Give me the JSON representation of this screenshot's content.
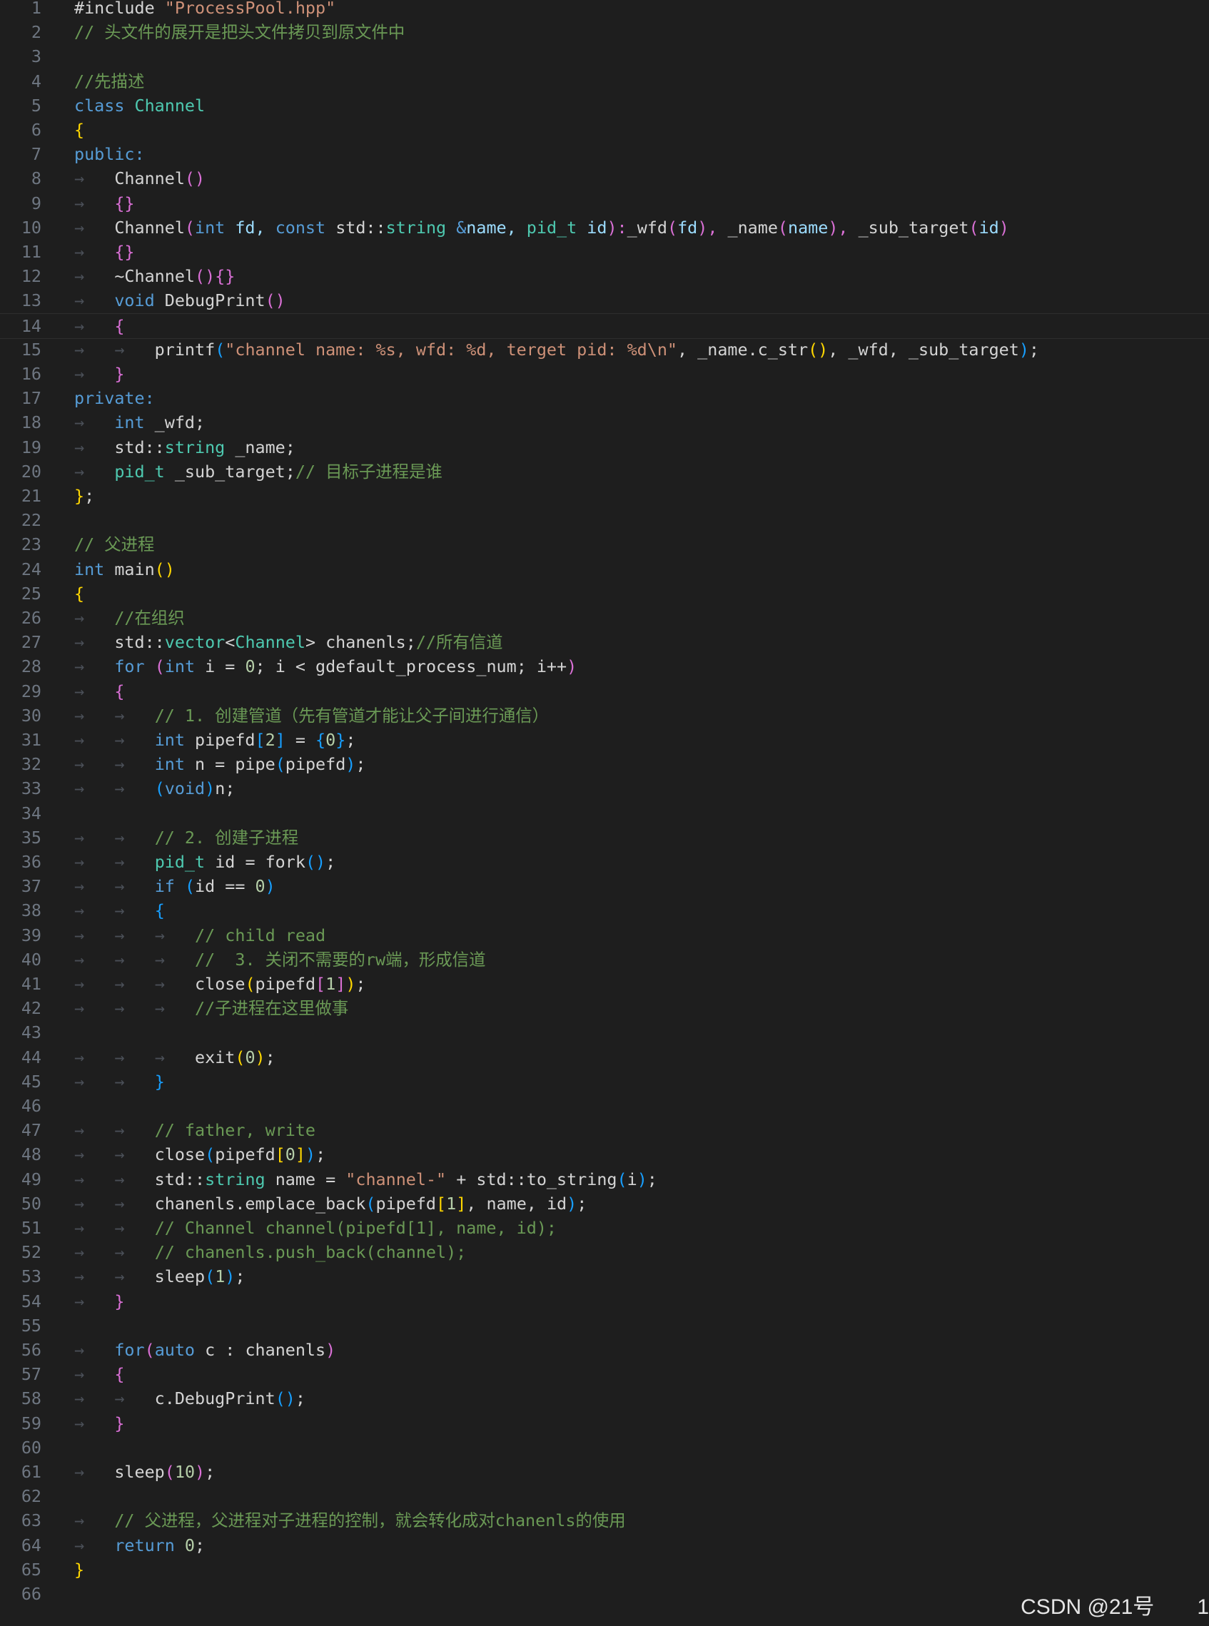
{
  "editor": {
    "lines": [
      [
        [
          "#include ",
          "plain"
        ],
        [
          "\"ProcessPool.hpp\"",
          "str"
        ]
      ],
      [
        [
          "// 头文件的展开是把头文件拷贝到原文件中",
          "cmt"
        ]
      ],
      [],
      [
        [
          "//先描述",
          "cmt"
        ]
      ],
      [
        [
          "class ",
          "kw"
        ],
        [
          "Channel",
          "type"
        ]
      ],
      [
        [
          "{",
          "br1"
        ]
      ],
      [
        [
          "public:",
          "kw"
        ]
      ],
      [
        [
          "→",
          "ws"
        ],
        [
          "   Channel",
          "plain"
        ],
        [
          "()",
          "br2"
        ]
      ],
      [
        [
          "→",
          "ws"
        ],
        [
          "   ",
          "plain"
        ],
        [
          "{}",
          "br2"
        ]
      ],
      [
        [
          "→",
          "ws"
        ],
        [
          "   Channel",
          "plain"
        ],
        [
          "(",
          "br2"
        ],
        [
          "int",
          "kw"
        ],
        [
          " fd, ",
          "param"
        ],
        [
          "const ",
          "kw"
        ],
        [
          "std::",
          "plain"
        ],
        [
          "string",
          "type"
        ],
        [
          " &",
          "kw"
        ],
        [
          "name, ",
          "param"
        ],
        [
          "pid_t",
          "type"
        ],
        [
          " id",
          "param"
        ],
        [
          "):",
          "br2"
        ],
        [
          "_wfd",
          "plain"
        ],
        [
          "(",
          "br2"
        ],
        [
          "fd",
          "param"
        ],
        [
          "), ",
          "br2"
        ],
        [
          "_name",
          "plain"
        ],
        [
          "(",
          "br2"
        ],
        [
          "name",
          "param"
        ],
        [
          "), ",
          "br2"
        ],
        [
          "_sub_target",
          "plain"
        ],
        [
          "(",
          "br2"
        ],
        [
          "id",
          "param"
        ],
        [
          ")",
          "br2"
        ]
      ],
      [
        [
          "→",
          "ws"
        ],
        [
          "   ",
          "plain"
        ],
        [
          "{}",
          "br2"
        ]
      ],
      [
        [
          "→",
          "ws"
        ],
        [
          "   ~Channel",
          "plain"
        ],
        [
          "(){}",
          "br2"
        ]
      ],
      [
        [
          "→",
          "ws"
        ],
        [
          "   ",
          "plain"
        ],
        [
          "void ",
          "kw"
        ],
        [
          "DebugPrint",
          "plain"
        ],
        [
          "()",
          "br2"
        ]
      ],
      [
        [
          "→",
          "ws"
        ],
        [
          "   ",
          "plain"
        ],
        [
          "{",
          "br2"
        ]
      ],
      [
        [
          "→",
          "ws"
        ],
        [
          "   ",
          "plain"
        ],
        [
          "→",
          "ws"
        ],
        [
          "   printf",
          "plain"
        ],
        [
          "(",
          "br3"
        ],
        [
          "\"channel name: %s, wfd: %d, terget pid: %d\\n\"",
          "str"
        ],
        [
          ", _name.c_str",
          "plain"
        ],
        [
          "()",
          "br1"
        ],
        [
          ", _wfd, _sub_target",
          "plain"
        ],
        [
          ")",
          "br3"
        ],
        [
          ";",
          "plain"
        ]
      ],
      [
        [
          "→",
          "ws"
        ],
        [
          "   ",
          "plain"
        ],
        [
          "}",
          "br2"
        ]
      ],
      [
        [
          "private:",
          "kw"
        ]
      ],
      [
        [
          "→",
          "ws"
        ],
        [
          "   ",
          "plain"
        ],
        [
          "int",
          "kw"
        ],
        [
          " _wfd;",
          "plain"
        ]
      ],
      [
        [
          "→",
          "ws"
        ],
        [
          "   std::",
          "plain"
        ],
        [
          "string",
          "type"
        ],
        [
          " _name;",
          "plain"
        ]
      ],
      [
        [
          "→",
          "ws"
        ],
        [
          "   ",
          "plain"
        ],
        [
          "pid_t",
          "type"
        ],
        [
          " _sub_target;",
          "plain"
        ],
        [
          "// 目标子进程是谁",
          "cmt"
        ]
      ],
      [
        [
          "}",
          "br1"
        ],
        [
          ";",
          "plain"
        ]
      ],
      [],
      [
        [
          "// 父进程",
          "cmt"
        ]
      ],
      [
        [
          "int",
          "kw"
        ],
        [
          " main",
          "plain"
        ],
        [
          "()",
          "br1"
        ]
      ],
      [
        [
          "{",
          "br1"
        ]
      ],
      [
        [
          "→",
          "ws"
        ],
        [
          "   ",
          "plain"
        ],
        [
          "//在组织",
          "cmt"
        ]
      ],
      [
        [
          "→",
          "ws"
        ],
        [
          "   std::",
          "plain"
        ],
        [
          "vector",
          "type"
        ],
        [
          "<",
          "plain"
        ],
        [
          "Channel",
          "type"
        ],
        [
          "> chanenls;",
          "plain"
        ],
        [
          "//所有信道",
          "cmt"
        ]
      ],
      [
        [
          "→",
          "ws"
        ],
        [
          "   ",
          "plain"
        ],
        [
          "for ",
          "kw"
        ],
        [
          "(",
          "br2"
        ],
        [
          "int",
          "kw"
        ],
        [
          " i = ",
          "plain"
        ],
        [
          "0",
          "num"
        ],
        [
          "; i < gdefault_process_num; i++",
          "plain"
        ],
        [
          ")",
          "br2"
        ]
      ],
      [
        [
          "→",
          "ws"
        ],
        [
          "   ",
          "plain"
        ],
        [
          "{",
          "br2"
        ]
      ],
      [
        [
          "→",
          "ws"
        ],
        [
          "   ",
          "plain"
        ],
        [
          "→",
          "ws"
        ],
        [
          "   ",
          "plain"
        ],
        [
          "// 1. 创建管道（先有管道才能让父子间进行通信）",
          "cmt"
        ]
      ],
      [
        [
          "→",
          "ws"
        ],
        [
          "   ",
          "plain"
        ],
        [
          "→",
          "ws"
        ],
        [
          "   ",
          "plain"
        ],
        [
          "int",
          "kw"
        ],
        [
          " pipefd",
          "plain"
        ],
        [
          "[",
          "br3"
        ],
        [
          "2",
          "num"
        ],
        [
          "]",
          "br3"
        ],
        [
          " = ",
          "plain"
        ],
        [
          "{",
          "br3"
        ],
        [
          "0",
          "num"
        ],
        [
          "}",
          "br3"
        ],
        [
          ";",
          "plain"
        ]
      ],
      [
        [
          "→",
          "ws"
        ],
        [
          "   ",
          "plain"
        ],
        [
          "→",
          "ws"
        ],
        [
          "   ",
          "plain"
        ],
        [
          "int",
          "kw"
        ],
        [
          " n = pipe",
          "plain"
        ],
        [
          "(",
          "br3"
        ],
        [
          "pipefd",
          "plain"
        ],
        [
          ")",
          "br3"
        ],
        [
          ";",
          "plain"
        ]
      ],
      [
        [
          "→",
          "ws"
        ],
        [
          "   ",
          "plain"
        ],
        [
          "→",
          "ws"
        ],
        [
          "   ",
          "plain"
        ],
        [
          "(",
          "br3"
        ],
        [
          "void",
          "kw"
        ],
        [
          ")",
          "br3"
        ],
        [
          "n;",
          "plain"
        ]
      ],
      [],
      [
        [
          "→",
          "ws"
        ],
        [
          "   ",
          "plain"
        ],
        [
          "→",
          "ws"
        ],
        [
          "   ",
          "plain"
        ],
        [
          "// 2. 创建子进程",
          "cmt"
        ]
      ],
      [
        [
          "→",
          "ws"
        ],
        [
          "   ",
          "plain"
        ],
        [
          "→",
          "ws"
        ],
        [
          "   ",
          "plain"
        ],
        [
          "pid_t",
          "type"
        ],
        [
          " id = fork",
          "plain"
        ],
        [
          "()",
          "br3"
        ],
        [
          ";",
          "plain"
        ]
      ],
      [
        [
          "→",
          "ws"
        ],
        [
          "   ",
          "plain"
        ],
        [
          "→",
          "ws"
        ],
        [
          "   ",
          "plain"
        ],
        [
          "if ",
          "kw"
        ],
        [
          "(",
          "br3"
        ],
        [
          "id == ",
          "plain"
        ],
        [
          "0",
          "num"
        ],
        [
          ")",
          "br3"
        ]
      ],
      [
        [
          "→",
          "ws"
        ],
        [
          "   ",
          "plain"
        ],
        [
          "→",
          "ws"
        ],
        [
          "   ",
          "plain"
        ],
        [
          "{",
          "br3"
        ]
      ],
      [
        [
          "→",
          "ws"
        ],
        [
          "   ",
          "plain"
        ],
        [
          "→",
          "ws"
        ],
        [
          "   ",
          "plain"
        ],
        [
          "→",
          "ws"
        ],
        [
          "   ",
          "plain"
        ],
        [
          "// child read",
          "cmt"
        ]
      ],
      [
        [
          "→",
          "ws"
        ],
        [
          "   ",
          "plain"
        ],
        [
          "→",
          "ws"
        ],
        [
          "   ",
          "plain"
        ],
        [
          "→",
          "ws"
        ],
        [
          "   ",
          "plain"
        ],
        [
          "//  3. 关闭不需要的rw端，形成信道",
          "cmt"
        ]
      ],
      [
        [
          "→",
          "ws"
        ],
        [
          "   ",
          "plain"
        ],
        [
          "→",
          "ws"
        ],
        [
          "   ",
          "plain"
        ],
        [
          "→",
          "ws"
        ],
        [
          "   close",
          "plain"
        ],
        [
          "(",
          "br1"
        ],
        [
          "pipefd",
          "plain"
        ],
        [
          "[",
          "br2"
        ],
        [
          "1",
          "num"
        ],
        [
          "]",
          "br2"
        ],
        [
          ")",
          "br1"
        ],
        [
          ";",
          "plain"
        ]
      ],
      [
        [
          "→",
          "ws"
        ],
        [
          "   ",
          "plain"
        ],
        [
          "→",
          "ws"
        ],
        [
          "   ",
          "plain"
        ],
        [
          "→",
          "ws"
        ],
        [
          "   ",
          "plain"
        ],
        [
          "//子进程在这里做事",
          "cmt"
        ]
      ],
      [],
      [
        [
          "→",
          "ws"
        ],
        [
          "   ",
          "plain"
        ],
        [
          "→",
          "ws"
        ],
        [
          "   ",
          "plain"
        ],
        [
          "→",
          "ws"
        ],
        [
          "   exit",
          "plain"
        ],
        [
          "(",
          "br1"
        ],
        [
          "0",
          "num"
        ],
        [
          ")",
          "br1"
        ],
        [
          ";",
          "plain"
        ]
      ],
      [
        [
          "→",
          "ws"
        ],
        [
          "   ",
          "plain"
        ],
        [
          "→",
          "ws"
        ],
        [
          "   ",
          "plain"
        ],
        [
          "}",
          "br3"
        ]
      ],
      [],
      [
        [
          "→",
          "ws"
        ],
        [
          "   ",
          "plain"
        ],
        [
          "→",
          "ws"
        ],
        [
          "   ",
          "plain"
        ],
        [
          "// father, write",
          "cmt"
        ]
      ],
      [
        [
          "→",
          "ws"
        ],
        [
          "   ",
          "plain"
        ],
        [
          "→",
          "ws"
        ],
        [
          "   close",
          "plain"
        ],
        [
          "(",
          "br3"
        ],
        [
          "pipefd",
          "plain"
        ],
        [
          "[",
          "br1"
        ],
        [
          "0",
          "num"
        ],
        [
          "]",
          "br1"
        ],
        [
          ")",
          "br3"
        ],
        [
          ";",
          "plain"
        ]
      ],
      [
        [
          "→",
          "ws"
        ],
        [
          "   ",
          "plain"
        ],
        [
          "→",
          "ws"
        ],
        [
          "   std::",
          "plain"
        ],
        [
          "string",
          "type"
        ],
        [
          " name = ",
          "plain"
        ],
        [
          "\"channel-\"",
          "str"
        ],
        [
          " + std::to_string",
          "plain"
        ],
        [
          "(",
          "br3"
        ],
        [
          "i",
          "plain"
        ],
        [
          ")",
          "br3"
        ],
        [
          ";",
          "plain"
        ]
      ],
      [
        [
          "→",
          "ws"
        ],
        [
          "   ",
          "plain"
        ],
        [
          "→",
          "ws"
        ],
        [
          "   chanenls.emplace_back",
          "plain"
        ],
        [
          "(",
          "br3"
        ],
        [
          "pipefd",
          "plain"
        ],
        [
          "[",
          "br1"
        ],
        [
          "1",
          "num"
        ],
        [
          "]",
          "br1"
        ],
        [
          ", name, id",
          "plain"
        ],
        [
          ")",
          "br3"
        ],
        [
          ";",
          "plain"
        ]
      ],
      [
        [
          "→",
          "ws"
        ],
        [
          "   ",
          "plain"
        ],
        [
          "→",
          "ws"
        ],
        [
          "   ",
          "plain"
        ],
        [
          "// Channel channel(pipefd[1], name, id);",
          "cmt"
        ]
      ],
      [
        [
          "→",
          "ws"
        ],
        [
          "   ",
          "plain"
        ],
        [
          "→",
          "ws"
        ],
        [
          "   ",
          "plain"
        ],
        [
          "// chanenls.push_back(channel);",
          "cmt"
        ]
      ],
      [
        [
          "→",
          "ws"
        ],
        [
          "   ",
          "plain"
        ],
        [
          "→",
          "ws"
        ],
        [
          "   sleep",
          "plain"
        ],
        [
          "(",
          "br3"
        ],
        [
          "1",
          "num"
        ],
        [
          ")",
          "br3"
        ],
        [
          ";",
          "plain"
        ]
      ],
      [
        [
          "→",
          "ws"
        ],
        [
          "   ",
          "plain"
        ],
        [
          "}",
          "br2"
        ]
      ],
      [],
      [
        [
          "→",
          "ws"
        ],
        [
          "   ",
          "plain"
        ],
        [
          "for",
          "kw"
        ],
        [
          "(",
          "br2"
        ],
        [
          "auto",
          "kw"
        ],
        [
          " c : chanenls",
          "plain"
        ],
        [
          ")",
          "br2"
        ]
      ],
      [
        [
          "→",
          "ws"
        ],
        [
          "   ",
          "plain"
        ],
        [
          "{",
          "br2"
        ]
      ],
      [
        [
          "→",
          "ws"
        ],
        [
          "   ",
          "plain"
        ],
        [
          "→",
          "ws"
        ],
        [
          "   c.DebugPrint",
          "plain"
        ],
        [
          "()",
          "br3"
        ],
        [
          ";",
          "plain"
        ]
      ],
      [
        [
          "→",
          "ws"
        ],
        [
          "   ",
          "plain"
        ],
        [
          "}",
          "br2"
        ]
      ],
      [],
      [
        [
          "→",
          "ws"
        ],
        [
          "   sleep",
          "plain"
        ],
        [
          "(",
          "br2"
        ],
        [
          "10",
          "num"
        ],
        [
          ")",
          "br2"
        ],
        [
          ";",
          "plain"
        ]
      ],
      [],
      [
        [
          "→",
          "ws"
        ],
        [
          "   ",
          "plain"
        ],
        [
          "// 父进程，父进程对子进程的控制，就会转化成对chanenls的使用",
          "cmt"
        ]
      ],
      [
        [
          "→",
          "ws"
        ],
        [
          "   ",
          "plain"
        ],
        [
          "return ",
          "kw"
        ],
        [
          "0",
          "num"
        ],
        [
          ";",
          "plain"
        ]
      ],
      [
        [
          "}",
          "br1"
        ]
      ],
      []
    ],
    "current_line": 14
  },
  "watermark": {
    "text": "CSDN @21号",
    "corner": "1"
  }
}
